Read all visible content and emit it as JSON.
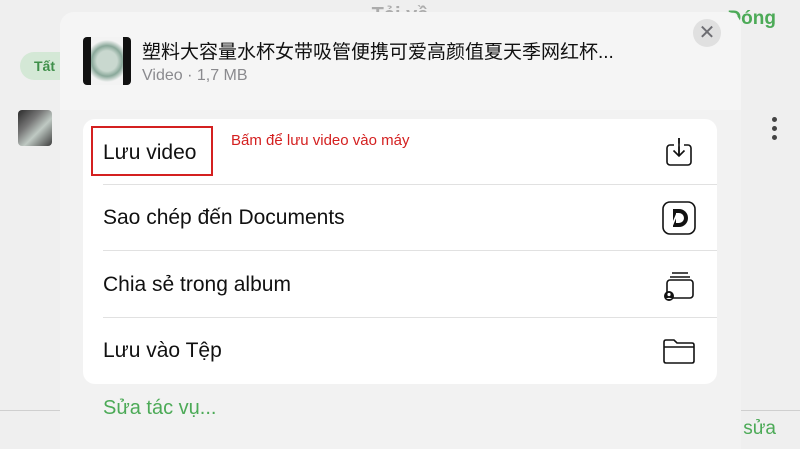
{
  "background": {
    "title": "Tải về",
    "done_label": "Đóng",
    "chip_label": "Tất",
    "edit_label": "sửa"
  },
  "sheet": {
    "file": {
      "title": "塑料大容量水杯女带吸管便携可爱高颜值夏天季网红杯...",
      "type": "Video",
      "size": "1,7 MB",
      "meta": "Video · 1,7 MB"
    },
    "close_label": "✕",
    "actions": [
      {
        "label": "Lưu video",
        "icon": "download-icon"
      },
      {
        "label": "Sao chép đến Documents",
        "icon": "documents-app-icon"
      },
      {
        "label": "Chia sẻ trong album",
        "icon": "shared-album-icon"
      },
      {
        "label": "Lưu vào Tệp",
        "icon": "folder-icon"
      }
    ],
    "annotation": "Bấm để lưu video vào máy",
    "edit_actions_label": "Sửa tác vụ..."
  },
  "colors": {
    "accent_green": "#4caa57",
    "annotation_red": "#d42020"
  }
}
